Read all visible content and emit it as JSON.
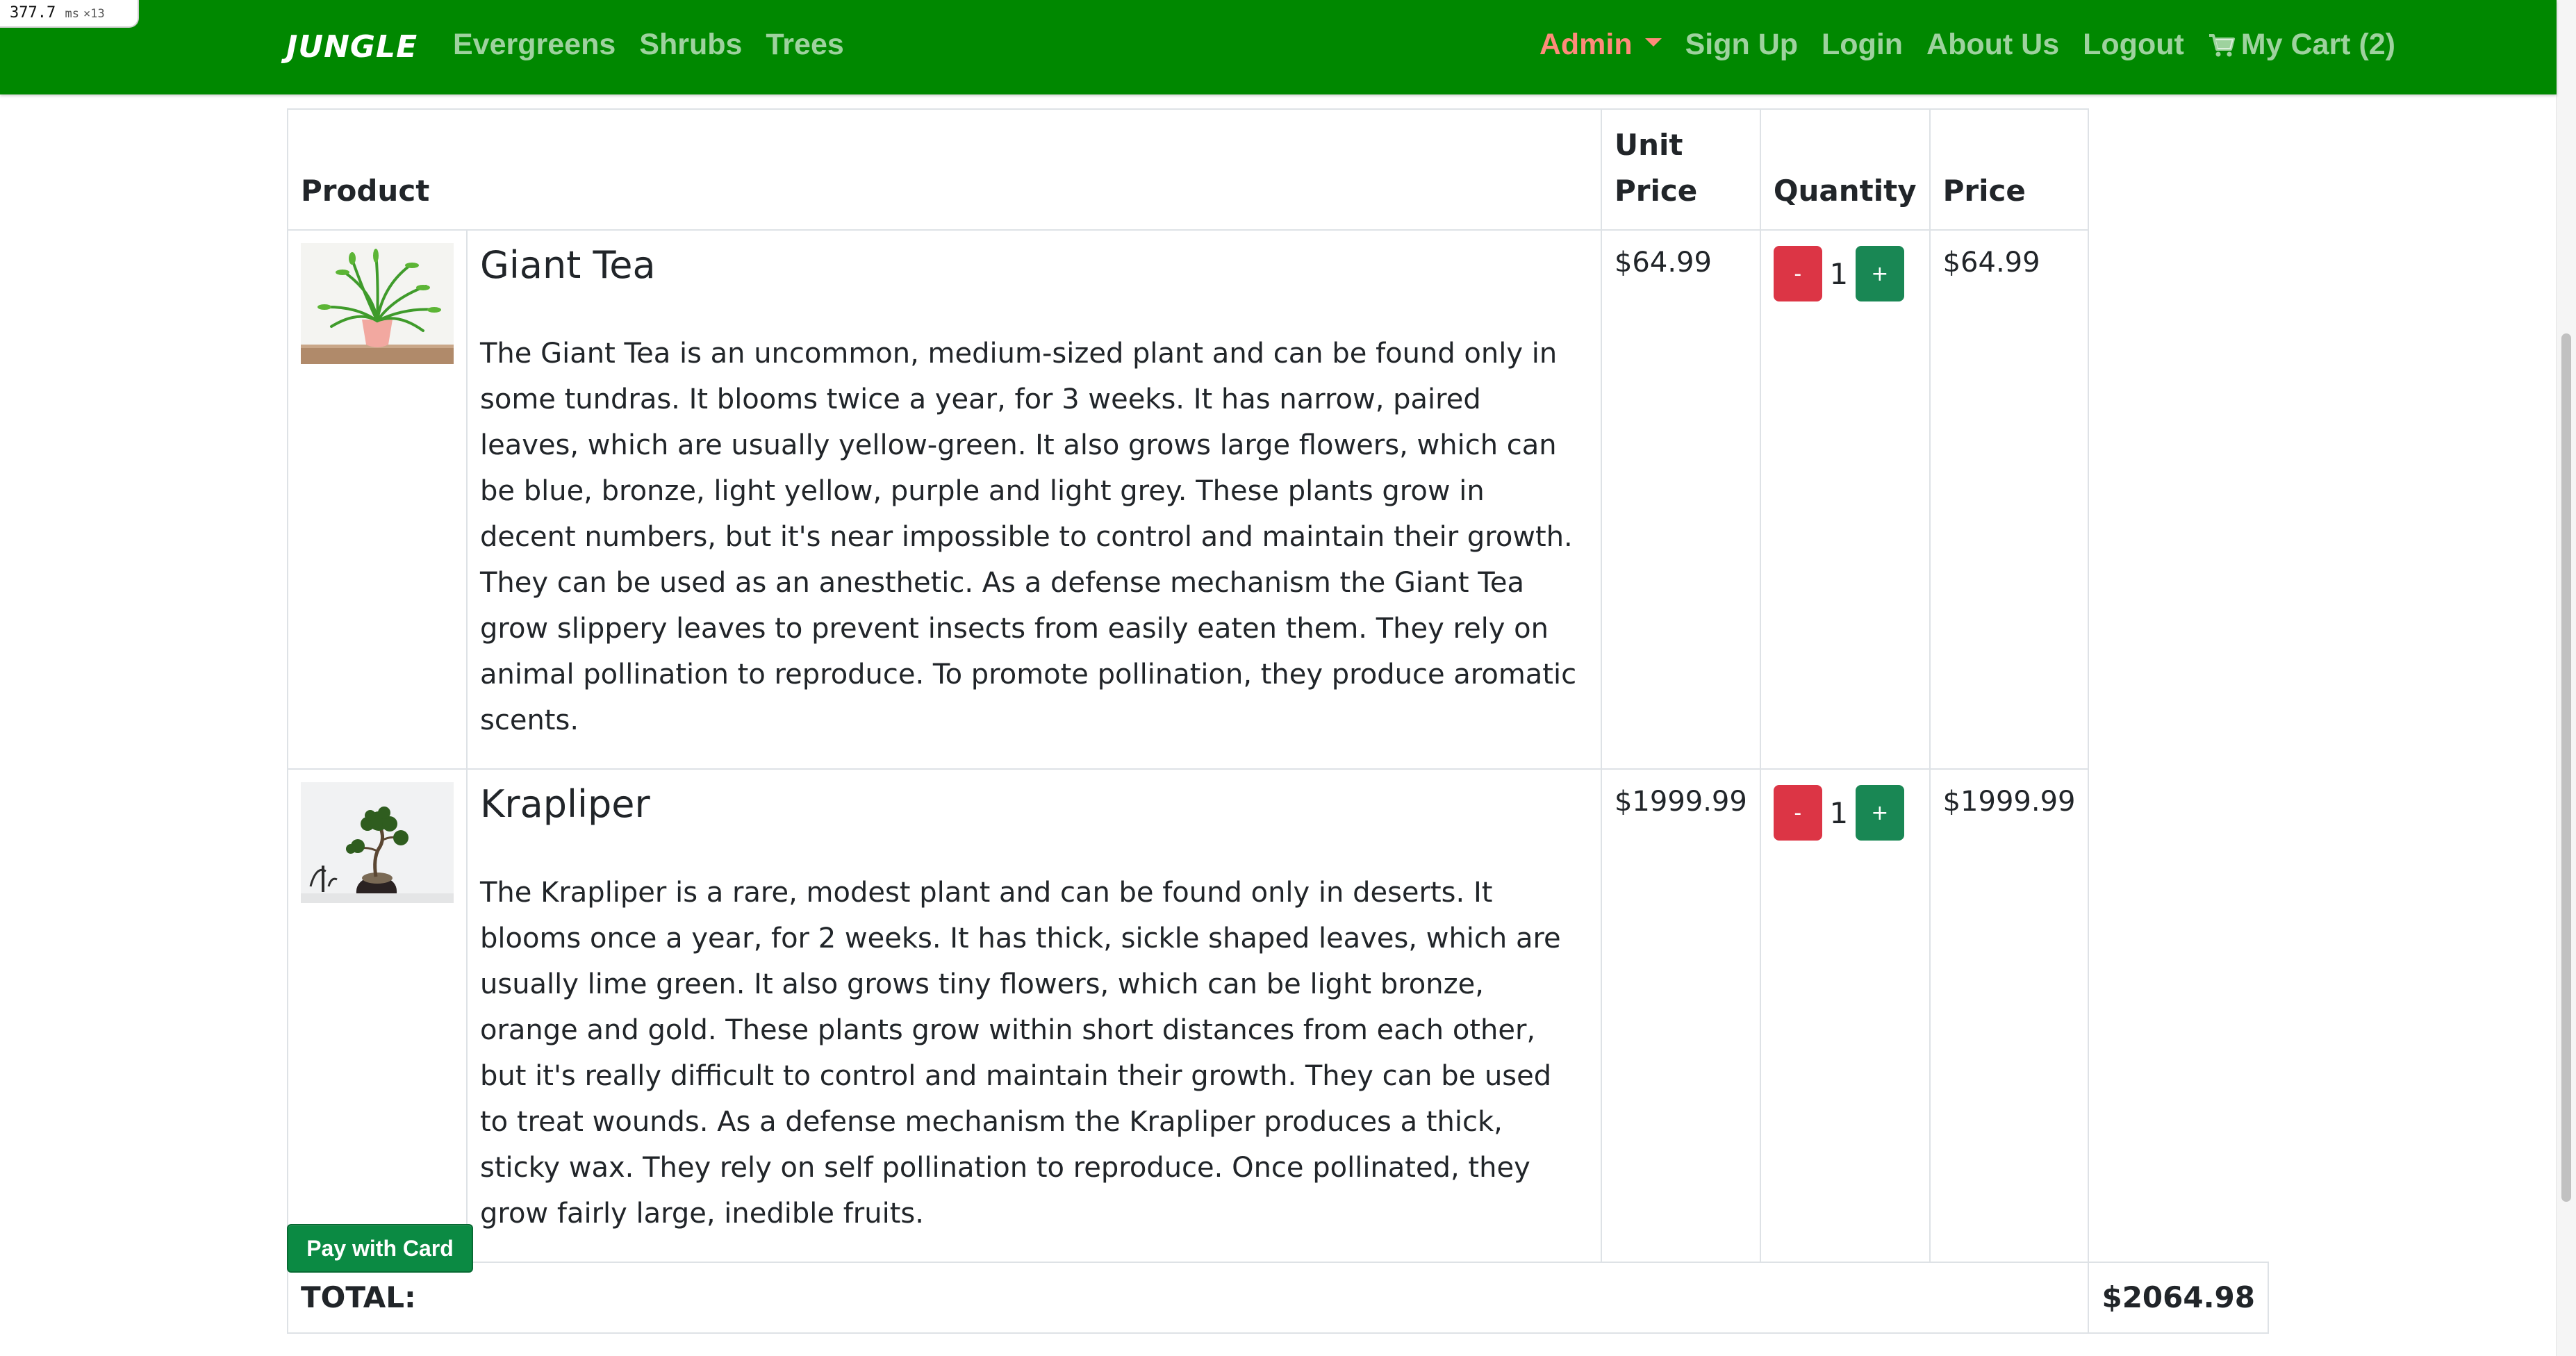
{
  "perf": {
    "value": "377.7",
    "unit": "ms",
    "multiplier": "×13"
  },
  "nav": {
    "brand": "JUNGLE",
    "left_links": [
      "Evergreens",
      "Shrubs",
      "Trees"
    ],
    "admin": "Admin",
    "sign_up": "Sign Up",
    "login": "Login",
    "about": "About Us",
    "logout": "Logout",
    "cart": "My Cart (2)"
  },
  "table": {
    "headers": {
      "product": "Product",
      "unit_price_1": "Unit",
      "unit_price_2": "Price",
      "quantity": "Quantity",
      "price": "Price"
    },
    "items": [
      {
        "name": "Giant Tea",
        "description": "The Giant Tea is an uncommon, medium-sized plant and can be found only in some tundras. It blooms twice a year, for 3 weeks. It has narrow, paired leaves, which are usually yellow-green. It also grows large flowers, which can be blue, bronze, light yellow, purple and light grey. These plants grow in decent numbers, but it's near impossible to control and maintain their growth. They can be used as an anesthetic. As a defense mechanism the Giant Tea grow slippery leaves to prevent insects from easily eaten them. They rely on animal pollination to reproduce. To promote pollination, they produce aromatic scents.",
        "unit_price": "$64.99",
        "quantity": "1",
        "price": "$64.99",
        "minus_label": "-",
        "plus_label": "+"
      },
      {
        "name": "Krapliper",
        "description": "The Krapliper is a rare, modest plant and can be found only in deserts. It blooms once a year, for 2 weeks. It has thick, sickle shaped leaves, which are usually lime green. It also grows tiny flowers, which can be light bronze, orange and gold. These plants grow within short distances from each other, but it's really difficult to control and maintain their growth. They can be used to treat wounds. As a defense mechanism the Krapliper produces a thick, sticky wax. They rely on self pollination to reproduce. Once pollinated, they grow fairly large, inedible fruits.",
        "unit_price": "$1999.99",
        "quantity": "1",
        "price": "$1999.99",
        "minus_label": "-",
        "plus_label": "+"
      }
    ],
    "total_label": "TOTAL:",
    "total_value": "$2064.98"
  },
  "pay_button": "Pay with Card",
  "colors": {
    "navbar": "#008800",
    "admin_link": "#ff8b7a",
    "minus_button": "#dc3545",
    "plus_button": "#198754",
    "pay_button": "#0b8a43"
  },
  "icons": {
    "cart": "shopping-cart-icon",
    "admin_caret": "caret-down-icon"
  }
}
